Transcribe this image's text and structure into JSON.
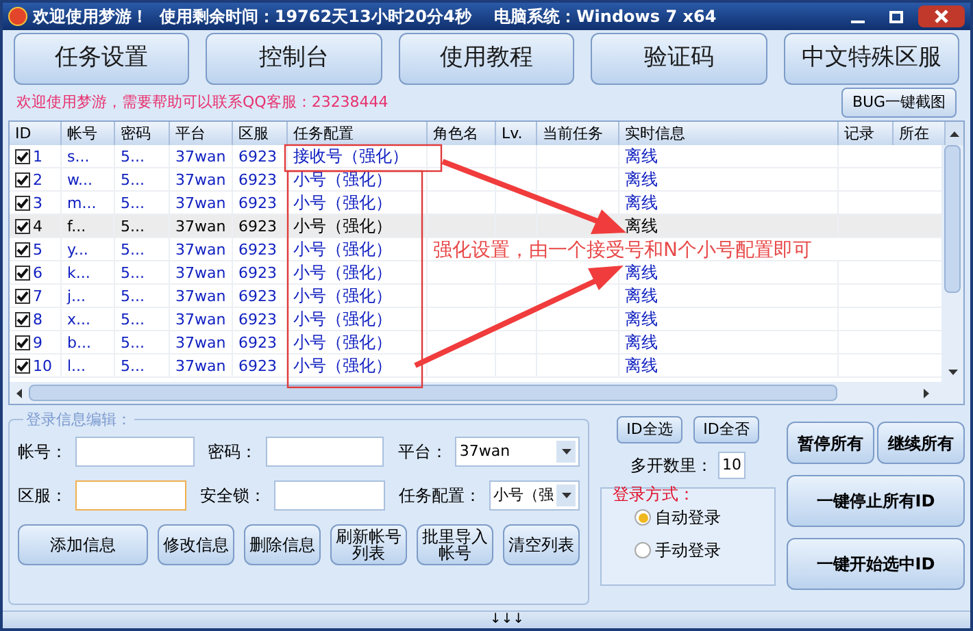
{
  "window": {
    "title": "欢迎使用梦游！  使用剩余时间：19762天13小时20分4秒    电脑系统：Windows 7 x64"
  },
  "tabs": [
    "任务设置",
    "控制台",
    "使用教程",
    "验证码",
    "中文特殊区服"
  ],
  "notice": "欢迎使用梦游，需要帮助可以联系QQ客服：23238444",
  "bug_button": "BUG一键截图",
  "table": {
    "columns": [
      "ID",
      "帐号",
      "密码",
      "平台",
      "区服",
      "任务配置",
      "角色名",
      "Lv.",
      "当前任务",
      "实时信息",
      "记录",
      "所在"
    ],
    "rows": [
      {
        "checked": true,
        "selected": false,
        "cells": [
          "1",
          "s...",
          "5...",
          "37wan",
          "6923",
          "接收号（强化）",
          "离线"
        ]
      },
      {
        "checked": true,
        "selected": false,
        "cells": [
          "2",
          "w...",
          "5...",
          "37wan",
          "6923",
          "小号（强化）",
          "离线"
        ]
      },
      {
        "checked": true,
        "selected": false,
        "cells": [
          "3",
          "m...",
          "5...",
          "37wan",
          "6923",
          "小号（强化）",
          "离线"
        ]
      },
      {
        "checked": true,
        "selected": true,
        "cells": [
          "4",
          "f...",
          "5...",
          "37wan",
          "6923",
          "小号（强化）",
          "离线"
        ]
      },
      {
        "checked": true,
        "selected": false,
        "cells": [
          "5",
          "y...",
          "5...",
          "37wan",
          "6923",
          "小号（强化）"
        ]
      },
      {
        "checked": true,
        "selected": false,
        "cells": [
          "6",
          "k...",
          "5...",
          "37wan",
          "6923",
          "小号（强化）",
          "离线"
        ]
      },
      {
        "checked": true,
        "selected": false,
        "cells": [
          "7",
          "j...",
          "5...",
          "37wan",
          "6923",
          "小号（强化）",
          "离线"
        ]
      },
      {
        "checked": true,
        "selected": false,
        "cells": [
          "8",
          "x...",
          "5...",
          "37wan",
          "6923",
          "小号（强化）",
          "离线"
        ]
      },
      {
        "checked": true,
        "selected": false,
        "cells": [
          "9",
          "b...",
          "5...",
          "37wan",
          "6923",
          "小号（强化）",
          "离线"
        ]
      },
      {
        "checked": true,
        "selected": false,
        "cells": [
          "10",
          "l...",
          "5...",
          "37wan",
          "6923",
          "小号（强化）",
          "离线"
        ]
      }
    ]
  },
  "annotation": {
    "text": "强化设置，由一个接受号和N个小号配置即可"
  },
  "edit_panel": {
    "legend": "登录信息编辑：",
    "fields": [
      {
        "label": "帐号：",
        "kind": "text",
        "focused": false
      },
      {
        "label": "密码：",
        "kind": "text",
        "focused": false
      },
      {
        "label": "平台：",
        "kind": "select",
        "value": "37wan",
        "focused": false
      },
      {
        "label": "区服：",
        "kind": "text",
        "focused": true
      },
      {
        "label": "安全锁：",
        "kind": "text",
        "focused": false
      },
      {
        "label": "任务配置：",
        "kind": "select",
        "value": "小号（强",
        "focused": false
      }
    ],
    "buttons": [
      "添加信息",
      "修改信息",
      "删除信息",
      "刷新帐号列表",
      "批里导入帐号",
      "清空列表"
    ]
  },
  "id_buttons": [
    "ID全选",
    "ID全否"
  ],
  "count": {
    "label": "多开数里：",
    "value": "10"
  },
  "login_mode": {
    "legend": "登录方式：",
    "options": [
      {
        "label": "自动登录",
        "selected": true
      },
      {
        "label": "手动登录",
        "selected": false
      }
    ]
  },
  "action_buttons": [
    "暂停所有",
    "继续所有",
    "一键停止所有ID",
    "一键开始选中ID"
  ],
  "status_bar": {
    "text": "↓↓↓"
  }
}
